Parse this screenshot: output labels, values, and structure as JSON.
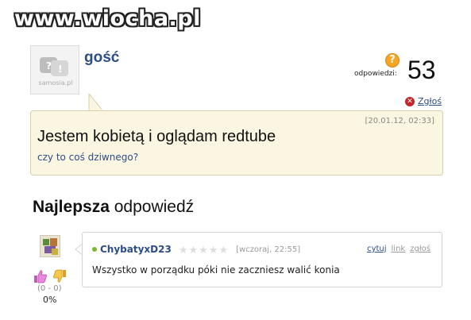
{
  "watermark": {
    "text": "www.wiocha.pl"
  },
  "question": {
    "author": "gość",
    "avatar_logo": "samosia.pl",
    "answers_label": "odpowiedzi:",
    "answers_count": "53",
    "report_label": "Zgłoś",
    "date": "[20.01.12, 02:33]",
    "title": "Jestem kobietą i oglądam redtube",
    "body": "czy to coś dziwnego?"
  },
  "best_answer": {
    "heading_bold": "Najlepsza",
    "heading_rest": " odpowiedź",
    "author": "ChybatyxD23",
    "rating_stars": 0,
    "rating_max": 5,
    "date": "[wczoraj, 22:55]",
    "links": {
      "cite": "cytuj",
      "link": "link",
      "report": "zgłoś"
    },
    "text": "Wszystko w porządku póki nie zaczniesz walić konia",
    "votes": "(0 - 0)",
    "percent": "0%"
  },
  "colors": {
    "link": "#2c4e86",
    "bubble_bg": "#fbf6e2",
    "question_icon": "#f5a623",
    "report_icon": "#c0262a",
    "online": "#7cb82f"
  },
  "icons": [
    "question-mark-icon",
    "report-icon",
    "thumbs-up-icon",
    "thumbs-down-icon",
    "star-icon",
    "online-status-icon"
  ]
}
